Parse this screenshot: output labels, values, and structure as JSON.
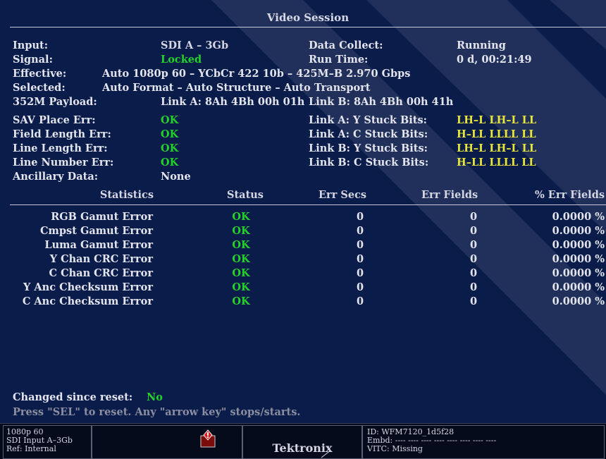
{
  "panel": {
    "title": "Video Session"
  },
  "info": {
    "input_label": "Input:",
    "input_value": "SDI A – 3Gb",
    "signal_label": "Signal:",
    "signal_value": "Locked",
    "effective_label": "Effective:",
    "effective_value": "Auto 1080p 60 – YCbCr 422 10b – 425M–B 2.970 Gbps",
    "selected_label": "Selected:",
    "selected_value": "Auto Format – Auto Structure – Auto Transport",
    "payload_label": "352M Payload:",
    "payload_link_a": "Link A: 8Ah 4Bh 00h 01h",
    "payload_link_b": "Link B: 8Ah 4Bh 00h 41h",
    "collect_label": "Data Collect:",
    "collect_value": "Running",
    "runtime_label": "Run Time:",
    "runtime_value": "0 d, 00:21:49"
  },
  "errors": [
    {
      "label": "SAV Place Err:",
      "value": "OK"
    },
    {
      "label": "Field Length Err:",
      "value": "OK"
    },
    {
      "label": "Line Length Err:",
      "value": "OK"
    },
    {
      "label": "Line Number Err:",
      "value": "OK"
    },
    {
      "label": "Ancillary Data:",
      "value": "None"
    }
  ],
  "stuck_bits": [
    {
      "label": "Link A: Y Stuck Bits:",
      "value": "LH–L LH–L LL"
    },
    {
      "label": "Link A: C Stuck Bits:",
      "value": "H–LL LLLL LL"
    },
    {
      "label": "Link B: Y Stuck Bits:",
      "value": "LH–L LH–L LL"
    },
    {
      "label": "Link B: C Stuck Bits:",
      "value": "H–LL LLLL LL"
    }
  ],
  "stats_table": {
    "headers": [
      "Statistics",
      "Status",
      "Err Secs",
      "Err Fields",
      "% Err Fields"
    ],
    "rows": [
      [
        "RGB Gamut Error",
        "OK",
        "0",
        "0",
        "0.0000 %"
      ],
      [
        "Cmpst Gamut Error",
        "OK",
        "0",
        "0",
        "0.0000 %"
      ],
      [
        "Luma Gamut Error",
        "OK",
        "0",
        "0",
        "0.0000 %"
      ],
      [
        "Y Chan CRC Error",
        "OK",
        "0",
        "0",
        "0.0000 %"
      ],
      [
        "C Chan CRC Error",
        "OK",
        "0",
        "0",
        "0.0000 %"
      ],
      [
        "Y Anc Checksum Error",
        "OK",
        "0",
        "0",
        "0.0000 %"
      ],
      [
        "C Anc Checksum Error",
        "OK",
        "0",
        "0",
        "0.0000 %"
      ]
    ]
  },
  "footer": {
    "changed_label": "Changed since reset:",
    "changed_value": "No",
    "hint": "Press \"SEL\" to reset.  Any \"arrow key\" stops/starts."
  },
  "status_bar": {
    "format": "1080p 60",
    "input": "SDI Input A–3Gb",
    "ref": "Ref: Internal",
    "brand": "Tektronix",
    "id": "ID: WFM7120_1d5f28",
    "embd": "Embd: ---- ---- ---- ---- ---- ---- ---- ----",
    "vitc": "VITC: Missing"
  },
  "colors": {
    "ok": "#22d22a",
    "stuck": "#e8e63a",
    "alert": "#e42222",
    "background": "#0a1c4a"
  }
}
